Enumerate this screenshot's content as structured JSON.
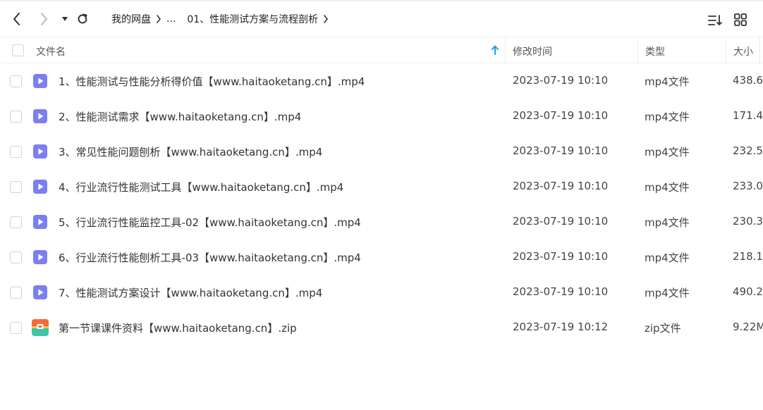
{
  "toolbar": {
    "breadcrumb": [
      "我的网盘",
      "...",
      "01、性能测试方案与流程剖析"
    ]
  },
  "header": {
    "name": "文件名",
    "mtime": "修改时间",
    "type": "类型",
    "size": "大小"
  },
  "icons": {
    "video_color": "#7b7ff0",
    "zip_color_top": "#f56a3d",
    "zip_color_bottom": "#3fc4a6",
    "sort_color": "#1a9dea"
  },
  "files": [
    {
      "name": "1、性能测试与性能分析得价值【www.haitaoketang.cn】.mp4",
      "mtime": "2023-07-19 10:10",
      "type": "mp4文件",
      "size": "438.6",
      "kind": "video"
    },
    {
      "name": "2、性能测试需求【www.haitaoketang.cn】.mp4",
      "mtime": "2023-07-19 10:10",
      "type": "mp4文件",
      "size": "171.4",
      "kind": "video"
    },
    {
      "name": "3、常见性能问题刨析【www.haitaoketang.cn】.mp4",
      "mtime": "2023-07-19 10:10",
      "type": "mp4文件",
      "size": "232.5",
      "kind": "video"
    },
    {
      "name": "4、行业流行性能测试工具【www.haitaoketang.cn】.mp4",
      "mtime": "2023-07-19 10:10",
      "type": "mp4文件",
      "size": "233.0",
      "kind": "video"
    },
    {
      "name": "5、行业流行性能监控工具-02【www.haitaoketang.cn】.mp4",
      "mtime": "2023-07-19 10:10",
      "type": "mp4文件",
      "size": "230.3",
      "kind": "video"
    },
    {
      "name": "6、行业流行性能刨析工具-03【www.haitaoketang.cn】.mp4",
      "mtime": "2023-07-19 10:10",
      "type": "mp4文件",
      "size": "218.1",
      "kind": "video"
    },
    {
      "name": "7、性能测试方案设计【www.haitaoketang.cn】.mp4",
      "mtime": "2023-07-19 10:10",
      "type": "mp4文件",
      "size": "490.2",
      "kind": "video"
    },
    {
      "name": "第一节课课件资料【www.haitaoketang.cn】.zip",
      "mtime": "2023-07-19 10:12",
      "type": "zip文件",
      "size": "9.22M",
      "kind": "zip"
    }
  ]
}
